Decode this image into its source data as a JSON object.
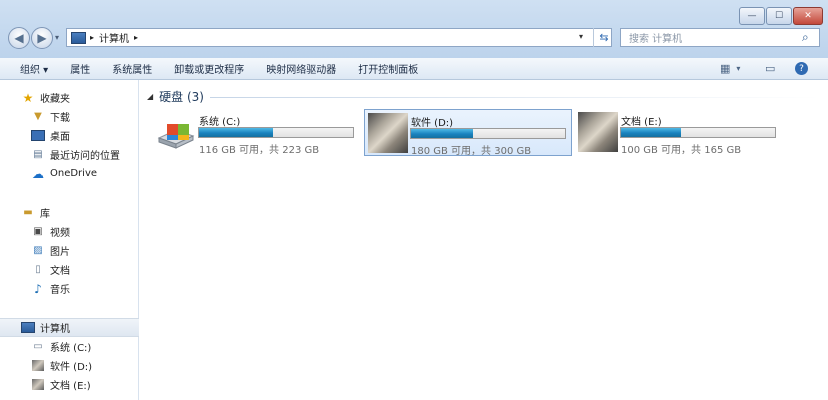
{
  "breadcrumb": {
    "separator": "▸",
    "current": "计算机"
  },
  "search": {
    "placeholder": "搜索 计算机"
  },
  "toolbar": {
    "items": [
      "组织 ▾",
      "属性",
      "系统属性",
      "卸载或更改程序",
      "映射网络驱动器",
      "打开控制面板"
    ]
  },
  "sidebar": {
    "favorites_label": "收藏夹",
    "favorites": [
      "下载",
      "桌面",
      "最近访问的位置"
    ],
    "onedrive": "OneDrive",
    "libraries_label": "库",
    "libraries": [
      "视频",
      "图片",
      "文档",
      "音乐"
    ],
    "computer_label": "计算机",
    "drives": [
      "系统 (C:)",
      "软件 (D:)",
      "文档 (E:)"
    ]
  },
  "group": {
    "title": "硬盘 (3)"
  },
  "drives": [
    {
      "name": "系统 (C:)",
      "free_text": "116 GB 可用，共 223 GB",
      "used_fraction": 0.48
    },
    {
      "name": "软件 (D:)",
      "free_text": "180 GB 可用，共 300 GB",
      "used_fraction": 0.4
    },
    {
      "name": "文档 (E:)",
      "free_text": "100 GB 可用，共 165 GB",
      "used_fraction": 0.39
    }
  ],
  "colors": {
    "accent": "#1a83bf",
    "selection": "#d8e8fb"
  }
}
